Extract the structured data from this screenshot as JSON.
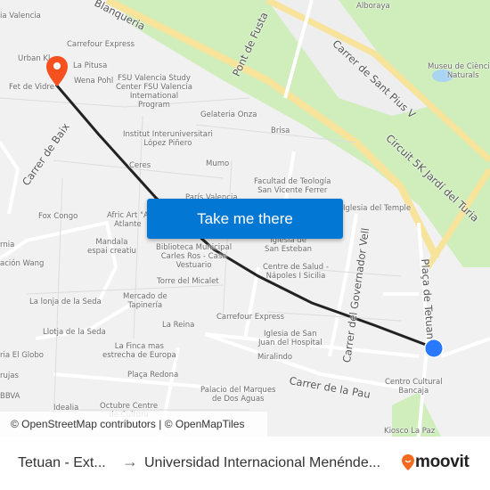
{
  "map": {
    "streets": [
      {
        "name": "Blanqueria"
      },
      {
        "name": "Pont de Fusta"
      },
      {
        "name": "Carrer de Sant Pius V"
      },
      {
        "name": "Circuit 5K Jardí del Turia"
      },
      {
        "name": "Carrer de Baix"
      },
      {
        "name": "Carrer del Governador Vell"
      },
      {
        "name": "Plaça de Tetuan"
      },
      {
        "name": "Carrer de la Pau"
      }
    ],
    "places": [
      {
        "name": "ia Valencia"
      },
      {
        "name": "Carrefour Express"
      },
      {
        "name": "Urban Kl"
      },
      {
        "name": "La Pitusa"
      },
      {
        "name": "Wena Pohl"
      },
      {
        "name": "Fet de Vidre"
      },
      {
        "name": "FSU Valencia Study\nCenter FSU Valencia\nInternational\nProgram"
      },
      {
        "name": "Gelateria Onza"
      },
      {
        "name": "Alboraya"
      },
      {
        "name": "Museu de Ciències\nNaturals"
      },
      {
        "name": "Institut Interuniversitari\nLópez Piñero"
      },
      {
        "name": "Ceres"
      },
      {
        "name": "Mumo"
      },
      {
        "name": "Brisa"
      },
      {
        "name": "Facultad de Teología\nSan Vicente Ferrer"
      },
      {
        "name": "París Valencia"
      },
      {
        "name": "Iglesia del Temple"
      },
      {
        "name": "Fox Congo"
      },
      {
        "name": "Afric Art \"A\nAtlante"
      },
      {
        "name": "Mandala\nespai creatiu"
      },
      {
        "name": "Biblioteca Municipal\nCarles Ros - Casa\nVestuario"
      },
      {
        "name": "Iglesia de\nSan Esteban"
      },
      {
        "name": "Centre de Salud -\nNápoles I Sicilia"
      },
      {
        "name": "Torre del Micalet"
      },
      {
        "name": "Mercado de\nTapinería"
      },
      {
        "name": "La lonja de la Seda"
      },
      {
        "name": "Llotja de la Seda"
      },
      {
        "name": "La Reina"
      },
      {
        "name": "Carrefour Express"
      },
      {
        "name": "Iglesia de San\nJuan del Hospital"
      },
      {
        "name": "Miralindo"
      },
      {
        "name": "La Finca mas\nestrecha de Europa"
      },
      {
        "name": "Plaça Redona"
      },
      {
        "name": "Palacio del Marques\nde Dos Aguas"
      },
      {
        "name": "Centro Cultural\nBancaja"
      },
      {
        "name": "Kiosco La Paz"
      },
      {
        "name": "ria El Globo"
      },
      {
        "name": "rujas"
      },
      {
        "name": "BBVA"
      },
      {
        "name": "Idealia"
      },
      {
        "name": "Octubre Centre\nde Cultura"
      },
      {
        "name": "rnia"
      },
      {
        "name": "ación Wang"
      }
    ],
    "route_color": "#222222",
    "origin_marker_color": "#2979ff",
    "destination_marker_color": "#f4511e",
    "attribution": "© OpenStreetMap contributors | © OpenMapTiles"
  },
  "cta": {
    "label": "Take me there"
  },
  "footer": {
    "from": "Tetuan - Ext...",
    "arrow": "→",
    "to": "Universidad Internacional Menénde...",
    "brand": "moovit",
    "brand_color": "#f46a1f"
  }
}
